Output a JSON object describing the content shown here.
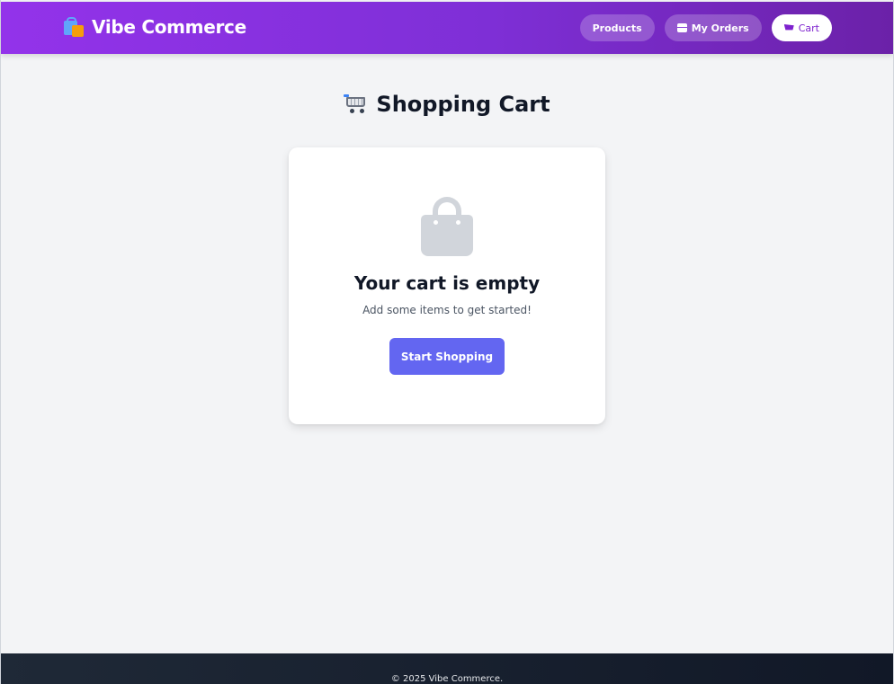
{
  "header": {
    "brand": "Vibe Commerce",
    "brand_icon": "shopping-bags-icon",
    "nav": [
      {
        "label": "Products",
        "icon": ""
      },
      {
        "label": "My Orders",
        "icon": "box-icon"
      },
      {
        "label": "Cart",
        "icon": "cart-icon",
        "active": true
      }
    ]
  },
  "main": {
    "title": "Shopping Cart",
    "title_icon": "shopping-cart-icon",
    "empty_state": {
      "icon": "shopping-bag-icon",
      "title": "Your cart is empty",
      "subtitle": "Add some items to get started!",
      "button_label": "Start Shopping"
    }
  },
  "footer": {
    "text": "© 2025 Vibe Commerce."
  },
  "colors": {
    "header_gradient_start": "#9333ea",
    "header_gradient_end": "#6b21a8",
    "accent_button": "#6366f1",
    "background": "#f3f4f6",
    "footer": "#1f2937"
  }
}
